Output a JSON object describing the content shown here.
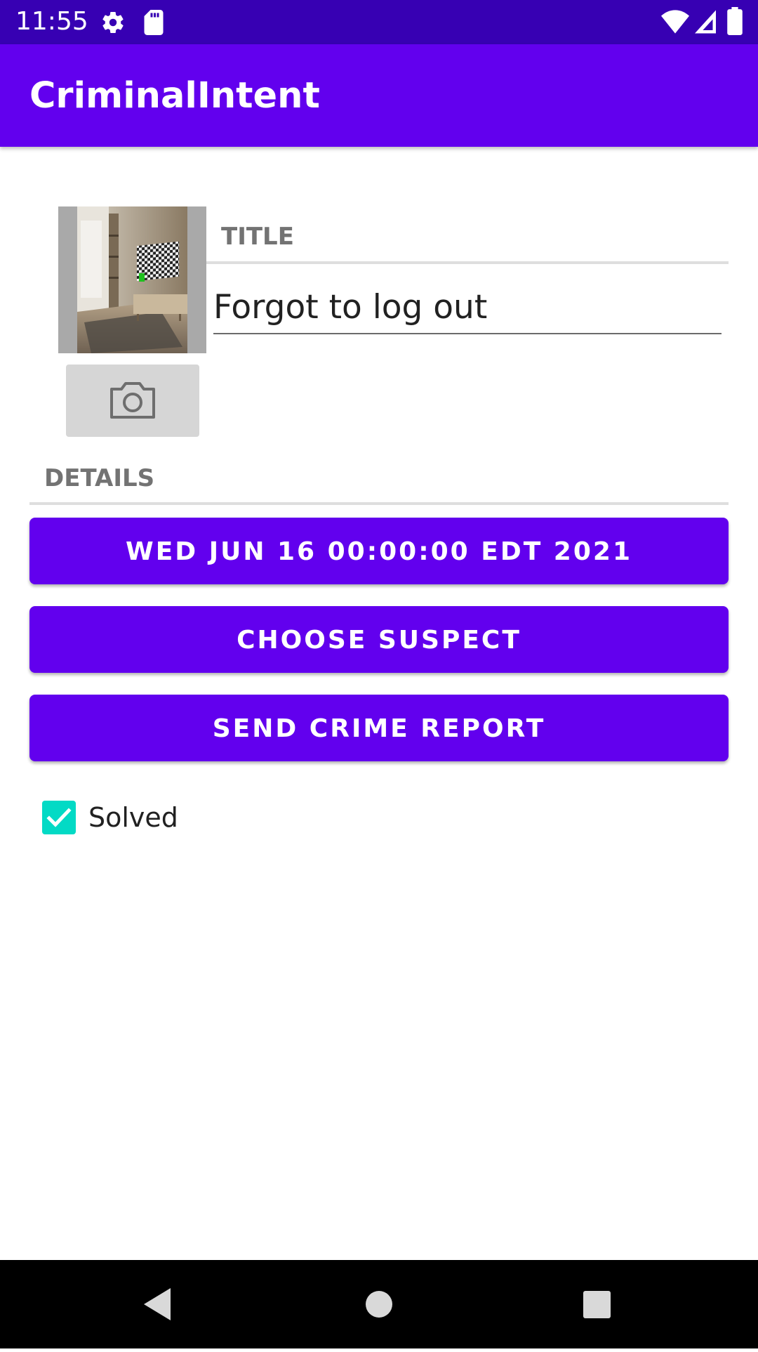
{
  "status_bar": {
    "time": "11:55",
    "icons": [
      "settings-icon",
      "sd-card-icon",
      "wifi-icon",
      "signal-icon",
      "battery-icon"
    ]
  },
  "app_bar": {
    "title": "CriminalIntent"
  },
  "crime": {
    "title_label": "TITLE",
    "title_value": "Forgot to log out",
    "details_label": "DETAILS",
    "date_button": "WED JUN 16 00:00:00 EDT 2021",
    "suspect_button": "CHOOSE SUSPECT",
    "report_button": "SEND CRIME REPORT",
    "solved_label": "Solved",
    "solved": true
  },
  "nav_bar": {
    "icons": [
      "back-icon",
      "home-icon",
      "recents-icon"
    ]
  },
  "colors": {
    "primary": "#6200ee",
    "primary_dark": "#3700b3",
    "accent": "#03dac5"
  }
}
